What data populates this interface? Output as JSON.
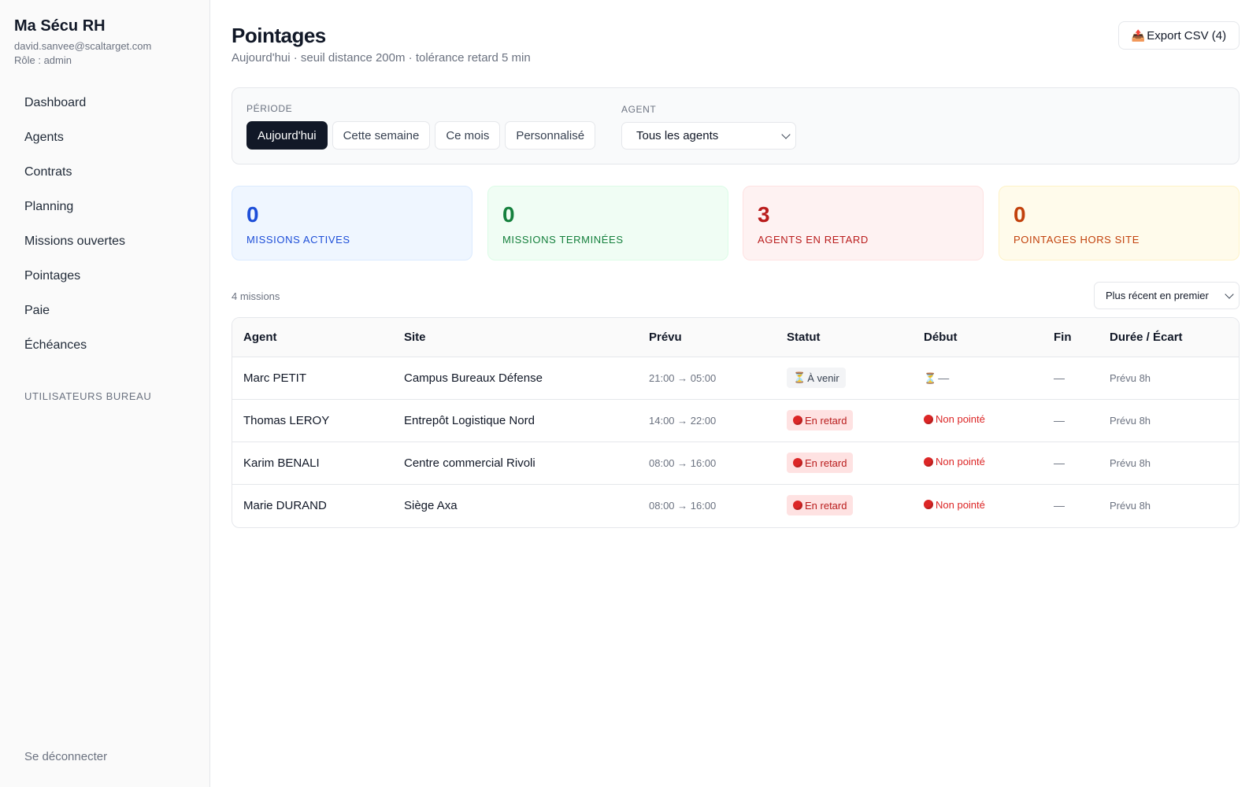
{
  "sidebar": {
    "brand": "Ma Sécu RH",
    "email": "david.sanvee@scaltarget.com",
    "role": "Rôle : admin",
    "items": [
      {
        "label": "Dashboard"
      },
      {
        "label": "Agents"
      },
      {
        "label": "Contrats"
      },
      {
        "label": "Planning"
      },
      {
        "label": "Missions ouvertes"
      },
      {
        "label": "Pointages"
      },
      {
        "label": "Paie"
      },
      {
        "label": "Échéances"
      }
    ],
    "section_label": "UTILISATEURS BUREAU",
    "logout": "Se déconnecter"
  },
  "header": {
    "title": "Pointages",
    "subtitle": "Aujourd'hui · seuil distance 200m · tolérance retard 5 min",
    "export_label": "Export CSV (4)"
  },
  "filters": {
    "periode_label": "PÉRIODE",
    "periods": [
      {
        "label": "Aujourd'hui"
      },
      {
        "label": "Cette semaine"
      },
      {
        "label": "Ce mois"
      },
      {
        "label": "Personnalisé"
      }
    ],
    "agent_label": "AGENT",
    "agent_value": "Tous les agents"
  },
  "stats": [
    {
      "value": "0",
      "label": "MISSIONS ACTIVES",
      "color": "#1d4ed8",
      "bg": "#eff6ff",
      "border": "#dbeafe"
    },
    {
      "value": "0",
      "label": "MISSIONS TERMINÉES",
      "color": "#15803d",
      "bg": "#f0fdf4",
      "border": "#dcfce7"
    },
    {
      "value": "3",
      "label": "AGENTS EN RETARD",
      "color": "#b91c1c",
      "bg": "#fef2f2",
      "border": "#fee2e2"
    },
    {
      "value": "0",
      "label": "POINTAGES HORS SITE",
      "color": "#c2410c",
      "bg": "#fffbeb",
      "border": "#fef3c7"
    }
  ],
  "list": {
    "count": "4 missions",
    "sort_value": "Plus récent en premier"
  },
  "table": {
    "headers": [
      "Agent",
      "Site",
      "Prévu",
      "Statut",
      "Début",
      "Fin",
      "Durée / Écart"
    ],
    "rows": [
      {
        "agent": "Marc PETIT",
        "site": "Campus Bureaux Défense",
        "prevu": "21:00 → 05:00",
        "statut": "À venir",
        "debut": "—",
        "fin": "—",
        "duree": "Prévu 8h"
      },
      {
        "agent": "Thomas LEROY",
        "site": "Entrepôt Logistique Nord",
        "prevu": "14:00 → 22:00",
        "statut": "En retard",
        "debut": "Non pointé",
        "fin": "—",
        "duree": "Prévu 8h"
      },
      {
        "agent": "Karim BENALI",
        "site": "Centre commercial Rivoli",
        "prevu": "08:00 → 16:00",
        "statut": "En retard",
        "debut": "Non pointé",
        "fin": "—",
        "duree": "Prévu 8h"
      },
      {
        "agent": "Marie DURAND",
        "site": "Siège Axa",
        "prevu": "08:00 → 16:00",
        "statut": "En retard",
        "debut": "Non pointé",
        "fin": "—",
        "duree": "Prévu 8h"
      }
    ]
  }
}
